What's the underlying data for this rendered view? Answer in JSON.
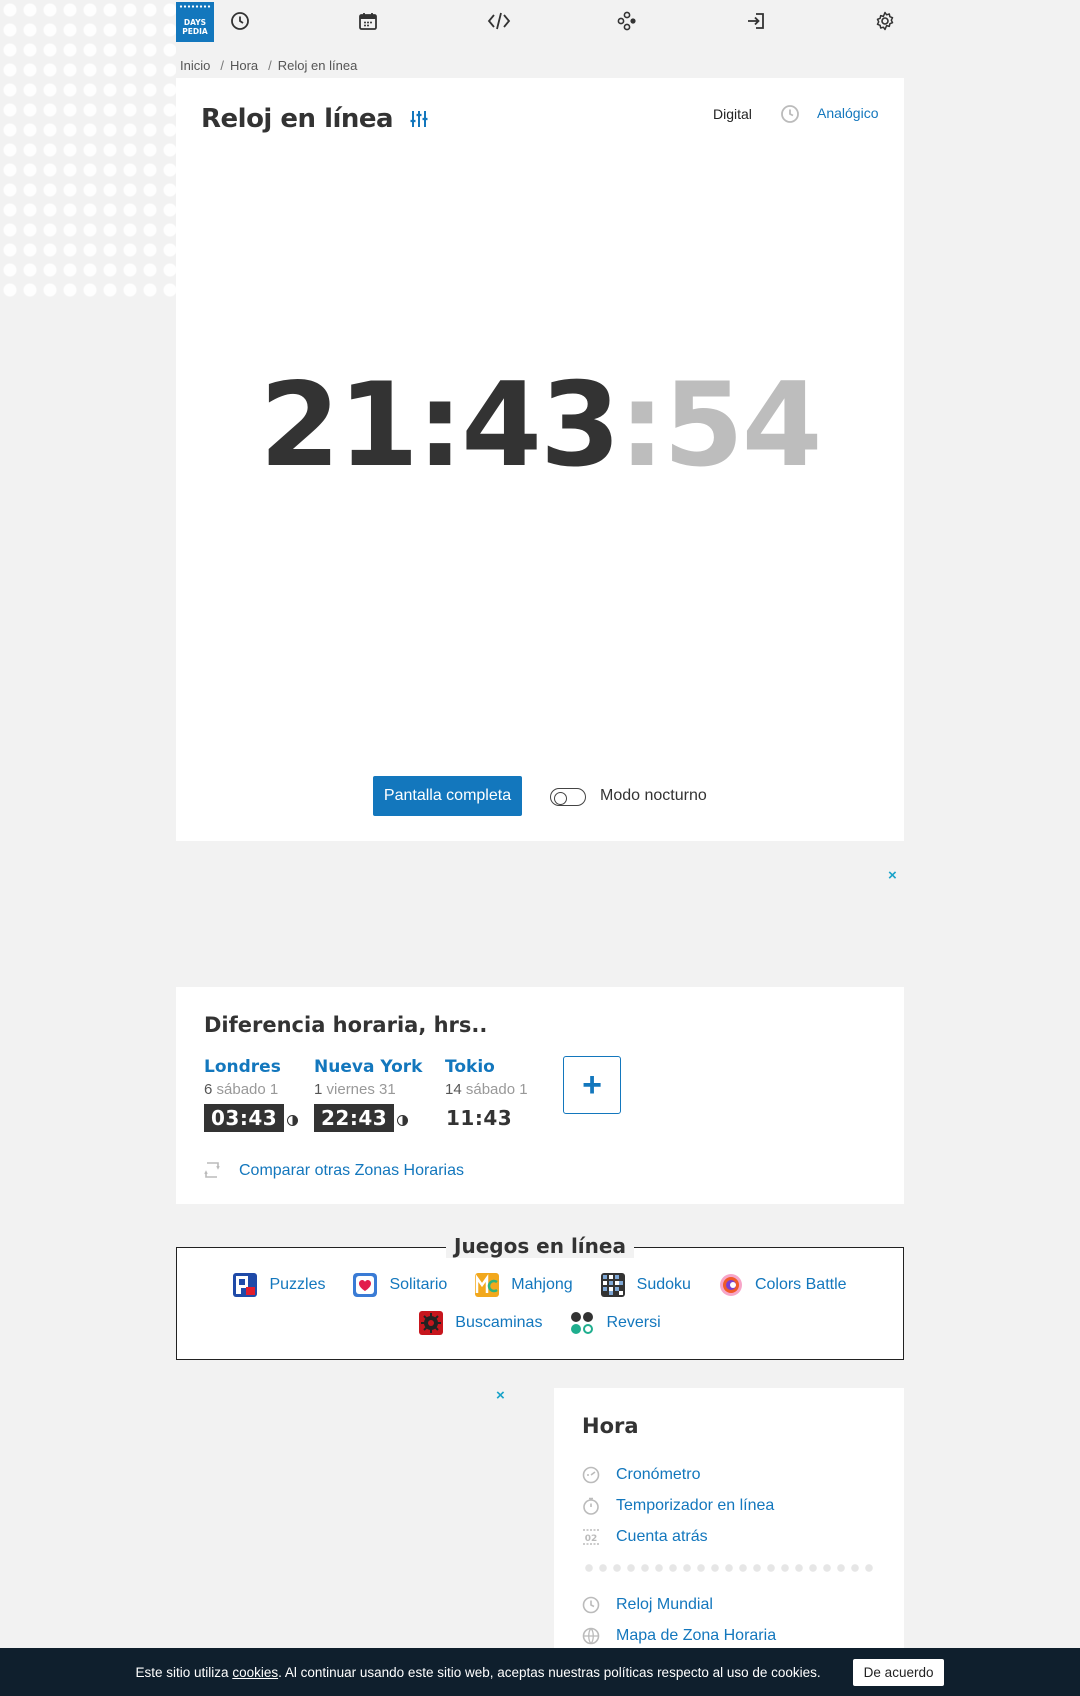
{
  "logo": {
    "line1": "DAYS",
    "line2": "PEDIA"
  },
  "nav": {
    "icons": [
      "clock-icon",
      "calendar-icon",
      "code-icon",
      "games-icon",
      "login-icon",
      "gear-icon"
    ]
  },
  "breadcrumb": [
    "Inicio",
    "Hora",
    "Reloj en línea"
  ],
  "clock": {
    "title": "Reloj en línea",
    "mode_digital": "Digital",
    "mode_analog": "Analógico",
    "hours_minutes": "21:43",
    "seconds": ":54",
    "fullscreen_label": "Pantalla completa",
    "night_mode_label": "Modo nocturno"
  },
  "ad_close": "×",
  "time_diff": {
    "title": "Diferencia horaria, hrs..",
    "cities": [
      {
        "name": "Londres",
        "offset": "6",
        "day": "sábado 1",
        "time": "03:43",
        "style": "dark"
      },
      {
        "name": "Nueva York",
        "offset": "1",
        "day": "viernes 31",
        "time": "22:43",
        "style": "dark"
      },
      {
        "name": "Tokio",
        "offset": "14",
        "day": "sábado 1",
        "time": "11:43",
        "style": "light"
      }
    ],
    "add_label": "+",
    "compare_label": "Comparar otras Zonas Horarias"
  },
  "games": {
    "title": "Juegos en línea",
    "items": [
      "Puzzles",
      "Solitario",
      "Mahjong",
      "Sudoku",
      "Colors Battle",
      "Buscaminas",
      "Reversi"
    ]
  },
  "sidebar": {
    "title": "Hora",
    "items": [
      "Cronómetro",
      "Temporizador en línea",
      "Cuenta atrás",
      "Reloj Mundial",
      "Mapa de Zona Horaria"
    ]
  },
  "cookie": {
    "before": "Este sitio utiliza ",
    "link": "cookies",
    "after": ". Al continuar usando este sitio web, aceptas nuestras políticas respecto al uso de cookies.",
    "button": "De acuerdo"
  },
  "colors": {
    "accent": "#1377bd",
    "dark": "#333333",
    "cookie_bg": "#0f1f2d"
  }
}
